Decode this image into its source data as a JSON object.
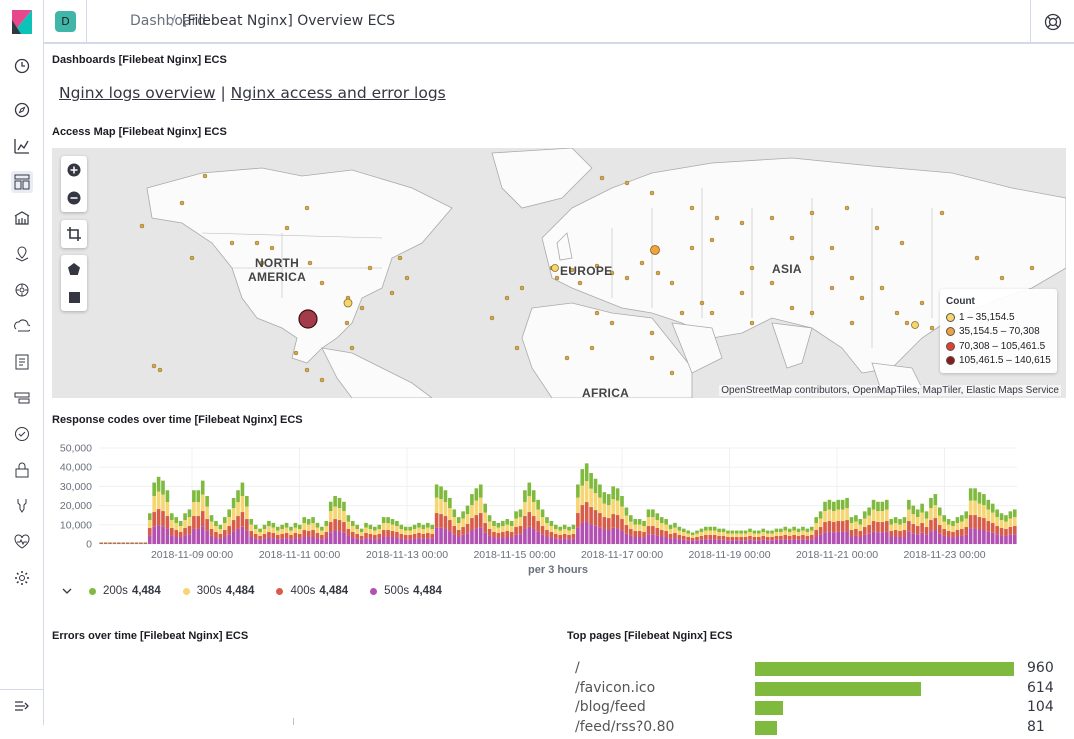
{
  "header": {
    "avatar_letter": "D",
    "breadcrumb_root": "Dashboard",
    "breadcrumb_sep": "/",
    "breadcrumb_current": "[Filebeat Nginx] Overview ECS"
  },
  "sidenav": {
    "icons": [
      "clock-icon",
      "compass-icon",
      "visualize-icon",
      "dashboard-icon",
      "canvas-icon",
      "maps-icon",
      "ml-icon",
      "infra-icon",
      "logs-icon",
      "apm-icon",
      "uptime-icon",
      "security-icon",
      "dev-tools-icon",
      "monitoring-icon",
      "management-icon"
    ],
    "collapse_icon": "collapse-icon"
  },
  "panels": {
    "links_title": "Dashboards [Filebeat Nginx] ECS",
    "link1": "Nginx logs overview",
    "link_sep": "|",
    "link2": "Nginx access and error logs",
    "map_title": "Access Map [Filebeat Nginx] ECS",
    "response_title": "Response codes over time [Filebeat Nginx] ECS",
    "errors_title": "Errors over time [Filebeat Nginx] ECS",
    "toppages_title": "Top pages [Filebeat Nginx] ECS"
  },
  "map": {
    "labels": {
      "north_america": "NORTH\nAMERICA",
      "europe": "EUROPE",
      "asia": "ASIA",
      "africa": "AFRICA"
    },
    "attribution": "OpenStreetMap contributors, OpenMapTiles, MapTiler, Elastic Maps Service",
    "legend": {
      "title": "Count",
      "entries": [
        {
          "label": "1 – 35,154.5",
          "color": "#f5d769"
        },
        {
          "label": "35,154.5 – 70,308",
          "color": "#f0a23c"
        },
        {
          "label": "70,308 – 105,461.5",
          "color": "#e0402e"
        },
        {
          "label": "105,461.5 – 140,615",
          "color": "#8b1a1a"
        }
      ]
    }
  },
  "chart_data": {
    "type": "bar",
    "stacked": true,
    "xlabel": "per 3 hours",
    "ylabel": "",
    "ylim": [
      0,
      50000
    ],
    "y_ticks": [
      "50,000",
      "40,000",
      "30,000",
      "20,000",
      "10,000",
      "0"
    ],
    "x_ticks": [
      "2018-11-09 00:00",
      "2018-11-11 00:00",
      "2018-11-13 00:00",
      "2018-11-15 00:00",
      "2018-11-17 00:00",
      "2018-11-19 00:00",
      "2018-11-21 00:00",
      "2018-11-23 00:00"
    ],
    "totals": [
      1000,
      1000,
      1000,
      1000,
      1000,
      1000,
      1000,
      1000,
      1000,
      1000,
      1000,
      16000,
      32000,
      35000,
      33000,
      28000,
      16000,
      14000,
      12000,
      16000,
      18000,
      28000,
      28000,
      33000,
      25000,
      15000,
      12000,
      10000,
      14000,
      18000,
      24000,
      28000,
      32000,
      25000,
      13000,
      10000,
      8000,
      10000,
      12000,
      11000,
      9000,
      10000,
      11000,
      9000,
      11000,
      10000,
      14000,
      13000,
      14000,
      11000,
      9000,
      12000,
      22000,
      25000,
      24000,
      22000,
      15000,
      12000,
      10000,
      8000,
      11000,
      10000,
      9000,
      10000,
      14000,
      14000,
      13000,
      12000,
      10000,
      9000,
      9000,
      10000,
      11000,
      10000,
      11000,
      10000,
      31000,
      30000,
      28000,
      24000,
      18000,
      14000,
      17000,
      20000,
      26000,
      29000,
      31000,
      21000,
      15000,
      12000,
      11000,
      12000,
      13000,
      12000,
      17000,
      18000,
      28000,
      32000,
      28000,
      23000,
      18000,
      14000,
      12000,
      10000,
      9000,
      10000,
      9000,
      10000,
      31000,
      39000,
      42000,
      37000,
      34000,
      31000,
      27000,
      26000,
      30000,
      29000,
      25000,
      19000,
      15000,
      13000,
      13000,
      12000,
      18000,
      18000,
      16000,
      14000,
      13000,
      10000,
      11000,
      9000,
      8000,
      7000,
      6000,
      7000,
      8000,
      9000,
      9000,
      9000,
      8000,
      8000,
      7000,
      7000,
      7000,
      7000,
      7000,
      8000,
      7000,
      7000,
      8000,
      7000,
      7000,
      8000,
      8000,
      9000,
      8000,
      9000,
      8000,
      9000,
      8000,
      9000,
      14000,
      17000,
      22000,
      23000,
      22000,
      23000,
      23000,
      24000,
      14000,
      15000,
      13000,
      17000,
      19000,
      23000,
      22000,
      22000,
      23000,
      13000,
      14000,
      13000,
      14000,
      23000,
      20000,
      18000,
      21000,
      17000,
      24000,
      26000,
      19000,
      15000,
      13000,
      12000,
      14000,
      15000,
      17000,
      29000,
      29000,
      27000,
      26000,
      23000,
      21000,
      18000,
      16000,
      15000,
      17000,
      18000
    ],
    "series": [
      {
        "name": "200s",
        "count": "4,484",
        "color": "#7fba3e",
        "share": 0.22
      },
      {
        "name": "300s",
        "count": "4,484",
        "color": "#f6d573",
        "share": 0.26
      },
      {
        "name": "400s",
        "count": "4,484",
        "color": "#d75d4a",
        "share": 0.24
      },
      {
        "name": "500s",
        "count": "4,484",
        "color": "#b251b1",
        "share": 0.28
      }
    ]
  },
  "top_pages": [
    {
      "page": "/",
      "count": "960",
      "value": 960
    },
    {
      "page": "/favicon.ico",
      "count": "614",
      "value": 614
    },
    {
      "page": "/blog/feed",
      "count": "104",
      "value": 104
    },
    {
      "page": "/feed/rss?0.80",
      "count": "81",
      "value": 81
    }
  ]
}
